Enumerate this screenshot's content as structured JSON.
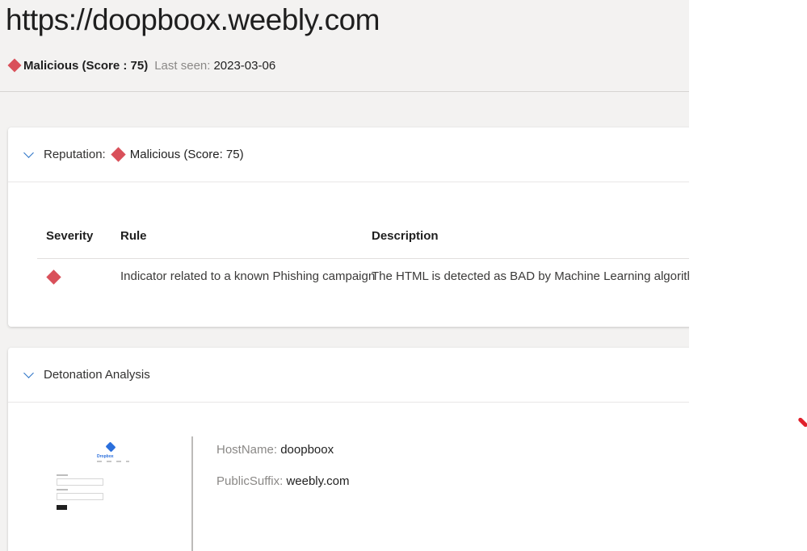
{
  "header": {
    "url": "https://doopboox.weebly.com",
    "verdict_icon": "malicious-diamond-icon",
    "verdict": "Malicious (Score : 75)",
    "last_seen_label": "Last seen:",
    "last_seen_value": "2023-03-06"
  },
  "reputation": {
    "label": "Reputation:",
    "verdict": "Malicious (Score: 75)",
    "table": {
      "columns": [
        "Severity",
        "Rule",
        "Description"
      ],
      "rows": [
        {
          "severity_icon": "malicious-diamond-icon",
          "rule": "Indicator related to a known Phishing campaign",
          "description": "The HTML is detected as BAD by Machine Learning algorithm."
        }
      ]
    }
  },
  "detonation": {
    "label": "Detonation Analysis",
    "thumbnail": {
      "logo_text": "Dropbox"
    },
    "properties": [
      {
        "label": "HostName:",
        "value": "doopboox"
      },
      {
        "label": "PublicSuffix:",
        "value": "weebly.com"
      }
    ]
  },
  "colors": {
    "malicious": "#d9505a",
    "accent": "#2b73c6",
    "page_background": "#f3f2f1"
  }
}
